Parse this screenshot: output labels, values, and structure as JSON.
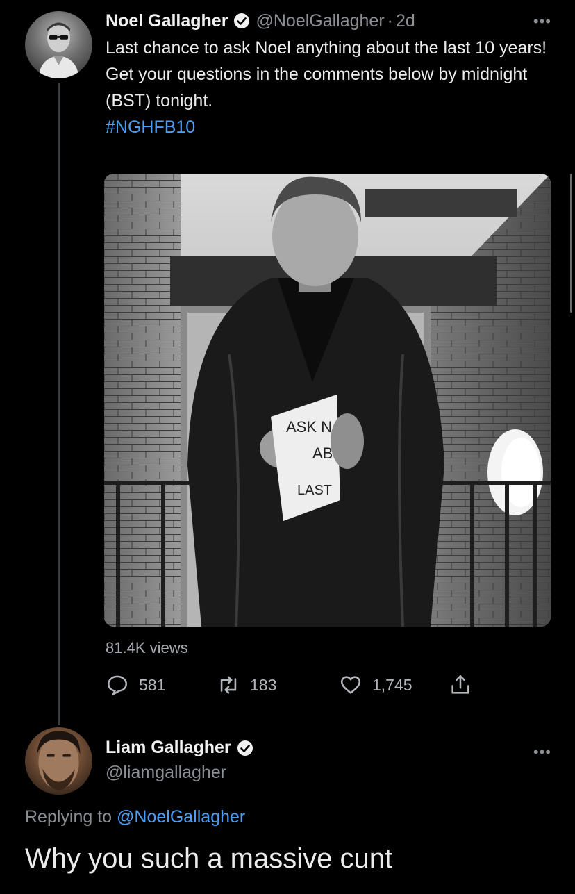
{
  "tweet": {
    "author_name": "Noel Gallagher",
    "author_handle": "@NoelGallagher",
    "separator": "·",
    "time": "2d",
    "more_icon": "more-dots-icon",
    "text_line_1": "Last chance to ask Noel anything about the last 10 years!",
    "text_line_2": "Get your questions in the comments below by midnight (BST) tonight.",
    "hashtag": "#NGHFB10",
    "media_sign_text": [
      "ASK N",
      "AB",
      "LAST"
    ],
    "views": "81.4K views",
    "actions": {
      "reply_count": "581",
      "retweet_count": "183",
      "like_count": "1,745"
    }
  },
  "reply": {
    "author_name": "Liam Gallagher",
    "author_handle": "@liamgallagher",
    "replying_prefix": "Replying to",
    "replying_to": "@NoelGallagher",
    "text": "Why you such a massive cunt"
  },
  "colors": {
    "background": "#000000",
    "link": "#4d9ff5",
    "secondary_text": "#8b8f94",
    "primary_text": "#ececec"
  }
}
